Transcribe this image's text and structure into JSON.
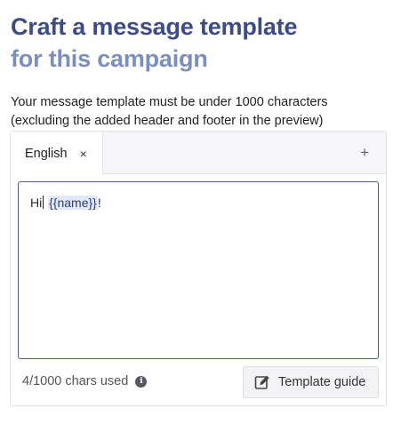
{
  "header": {
    "title_line1": "Craft a message template",
    "title_line2": "for this campaign",
    "description": "Your message template must be under 1000 characters\n(excluding the added header and footer in the preview)"
  },
  "tabs": [
    {
      "label": "English",
      "close_glyph": "×",
      "active": true
    }
  ],
  "add_tab_glyph": "+",
  "editor": {
    "text_before_caret": "Hi",
    "text_after_caret": " ",
    "variable": "{{name}}",
    "text_after_variable": "!"
  },
  "footer": {
    "char_count": "4/1000 chars used",
    "info_icon": "i",
    "guide_button_label": "Template guide",
    "guide_button_icon": "edit-icon"
  },
  "colors": {
    "title_primary": "#3d4c87",
    "title_secondary": "#7a8fbf",
    "editor_border": "#4d5b8c",
    "variable_highlight": "#e2e8f7"
  }
}
